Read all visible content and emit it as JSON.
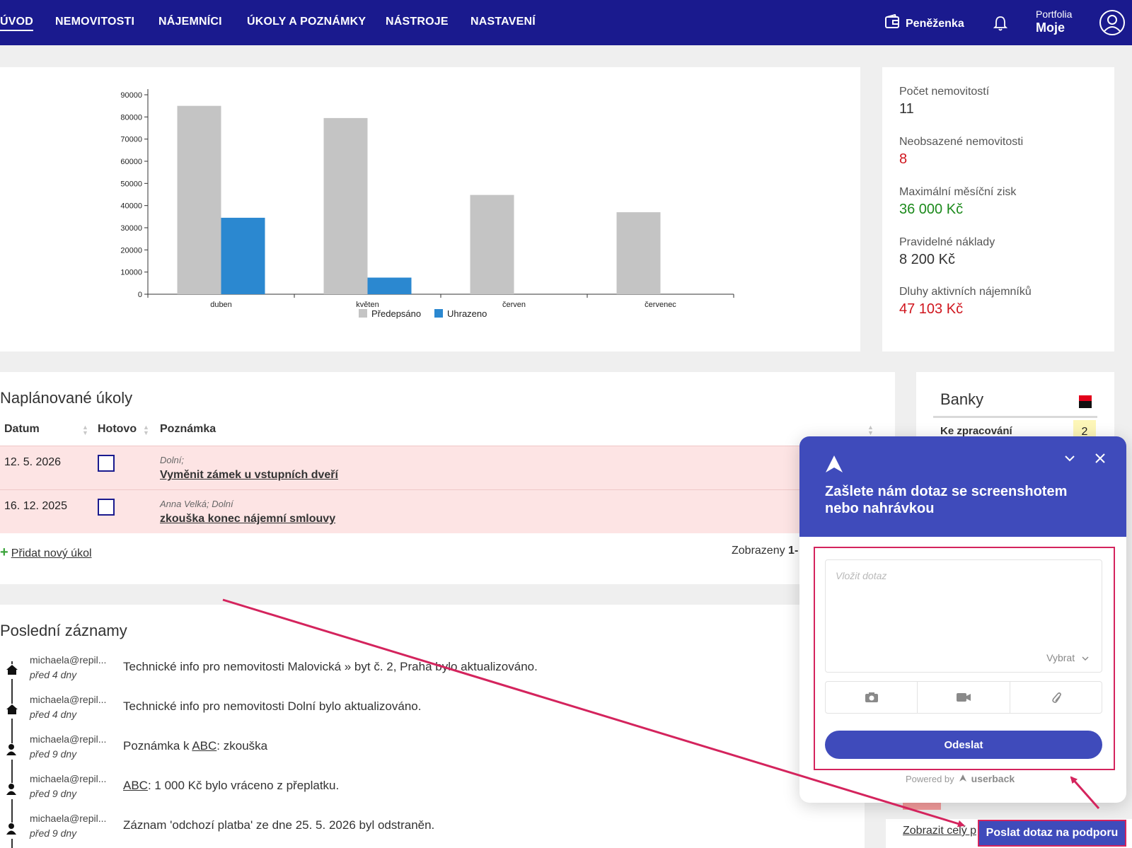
{
  "nav": {
    "items": [
      "ÚVOD",
      "NEMOVITOSTI",
      "NÁJEMNÍCI",
      "ÚKOLY A POZNÁMKY",
      "NÁSTROJE",
      "NASTAVENÍ"
    ],
    "wallet_label": "Peněženka",
    "portfolio_label": "Portfolia",
    "portfolio_value": "Moje"
  },
  "chart_data": {
    "type": "bar",
    "categories": [
      "duben",
      "květen",
      "červen",
      "červenec"
    ],
    "series": [
      {
        "name": "Předepsáno",
        "values": [
          85000,
          79500,
          44800,
          37000
        ],
        "color": "#c4c4c4"
      },
      {
        "name": "Uhrazeno",
        "values": [
          34500,
          7500,
          0,
          0
        ],
        "color": "#2b88d0"
      }
    ],
    "yticks": [
      "0",
      "10000",
      "20000",
      "30000",
      "40000",
      "50000",
      "60000",
      "70000",
      "80000",
      "90000"
    ],
    "ylim": [
      0,
      90000
    ],
    "legend": "bottom-center"
  },
  "stats": [
    {
      "label": "Počet nemovitostí",
      "value": "11",
      "color": "#333333"
    },
    {
      "label": "Neobsazené nemovitosti",
      "value": "8",
      "color": "#d0161e"
    },
    {
      "label": "Maximální měsíční zisk",
      "value": "36 000 Kč",
      "color": "#1c8a1c"
    },
    {
      "label": "Pravidelné náklady",
      "value": "8 200 Kč",
      "color": "#333333"
    },
    {
      "label": "Dluhy aktivních nájemníků",
      "value": "47 103 Kč",
      "color": "#d0161e"
    }
  ],
  "tasks": {
    "title": "Naplánované úkoly",
    "headers": {
      "date": "Datum",
      "done": "Hotovo",
      "note": "Poznámka"
    },
    "rows": [
      {
        "date": "12. 5. 2026",
        "sub": "Dolní;",
        "title": "Vyměnit zámek u vstupních dveří"
      },
      {
        "date": "16. 12. 2025",
        "sub": "Anna Velká; Dolní",
        "title": "zkouška konec nájemní smlouvy"
      }
    ],
    "add_label": "Přidat nový úkol",
    "shown_label": "Zobrazeny",
    "shown_range": "1-"
  },
  "banks": {
    "title": "Banky",
    "row_label": "Ke zpracování",
    "row_value": "2"
  },
  "records": {
    "title": "Poslední záznamy",
    "items": [
      {
        "icon": "house-icon",
        "who": "michaela@repil...",
        "when": "před 4 dny",
        "pre": "",
        "link": "",
        "post": "Technické info pro nemovitosti Malovická » byt č. 2, Praha bylo aktualizováno."
      },
      {
        "icon": "house-icon",
        "who": "michaela@repil...",
        "when": "před 4 dny",
        "pre": "",
        "link": "",
        "post": "Technické info pro nemovitosti Dolní bylo aktualizováno."
      },
      {
        "icon": "person-icon",
        "who": "michaela@repil...",
        "when": "před 9 dny",
        "pre": "Poznámka k ",
        "link": "ABC",
        "post": ": zkouška"
      },
      {
        "icon": "person-icon",
        "who": "michaela@repil...",
        "when": "před 9 dny",
        "pre": "",
        "link": "ABC",
        "post": ": 1 000 Kč bylo vráceno z přeplatku."
      },
      {
        "icon": "person-icon",
        "who": "michaela@repil...",
        "when": "před 9 dny",
        "pre": "",
        "link": "",
        "post": "Záznam 'odchozí platba' ze dne 25. 5. 2026 byl odstraněn."
      }
    ],
    "full_link": "Zobrazit celý p"
  },
  "widget": {
    "title": "Zašlete nám dotaz se screenshotem nebo nahrávkou",
    "placeholder": "Vložit dotaz",
    "select_label": "Vybrat",
    "send_label": "Odeslat",
    "powered_label": "Powered by",
    "powered_brand": "userback"
  },
  "support_button": "Poslat dotaz na podporu",
  "colors": {
    "navbar": "#1a1a8e",
    "widget_accent": "#3f4bbb",
    "annotation": "#d4245d",
    "task_row_bg": "#fde4e4"
  }
}
